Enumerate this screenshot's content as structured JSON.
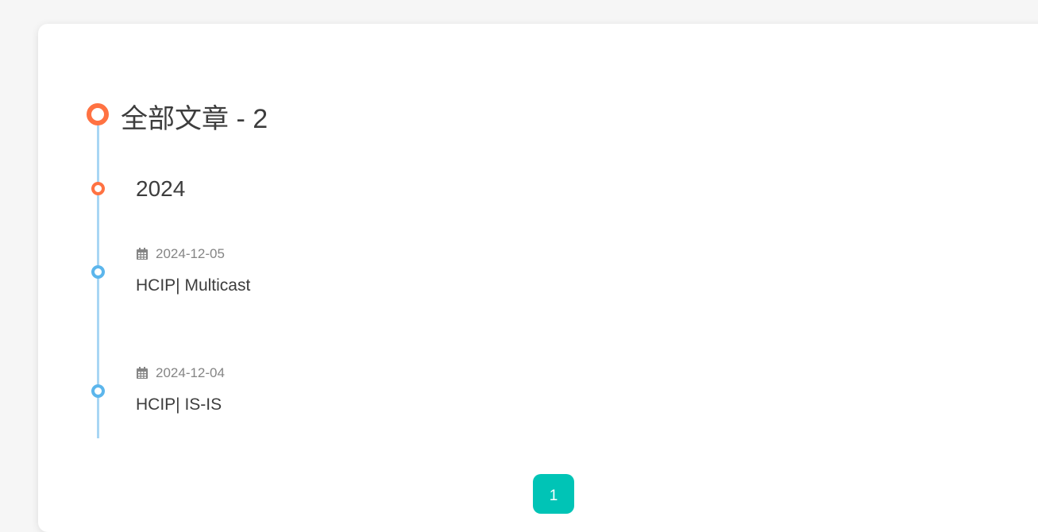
{
  "archive": {
    "title": "全部文章 - 2",
    "year": "2024",
    "posts": [
      {
        "date": "2024-12-05",
        "title": "HCIP| Multicast"
      },
      {
        "date": "2024-12-04",
        "title": "HCIP| IS-IS"
      }
    ]
  },
  "pagination": {
    "current_page": "1"
  },
  "colors": {
    "accent_orange": "#ff7242",
    "timeline_blue": "#5cb6ec",
    "timeline_line": "#a8d6f4",
    "pagination_teal": "#00c4b6"
  },
  "icons": {
    "date": "calendar-icon"
  }
}
